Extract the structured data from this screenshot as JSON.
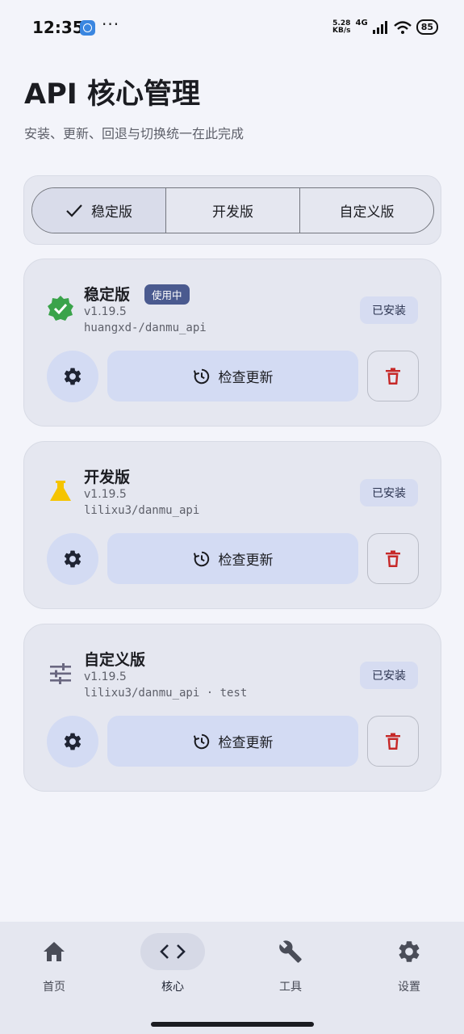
{
  "status_bar": {
    "time": "12:35",
    "dots": "···",
    "speed_value": "5.28",
    "speed_unit": "KB/s",
    "network": "4G",
    "battery": "85",
    "icons": [
      "app-icon",
      "signal-icon",
      "wifi-icon",
      "battery-icon"
    ]
  },
  "header": {
    "title": "API 核心管理",
    "subtitle": "安装、更新、回退与切换统一在此完成"
  },
  "segments": {
    "items": [
      {
        "label": "稳定版",
        "active": true
      },
      {
        "label": "开发版",
        "active": false
      },
      {
        "label": "自定义版",
        "active": false
      }
    ]
  },
  "cards": [
    {
      "name": "稳定版",
      "badge": "使用中",
      "version": "v1.19.5",
      "repo": "huangxd-/danmu_api",
      "status": "已安装",
      "update_label": "检查更新",
      "icon": "verified-badge-icon",
      "icon_color": "#3aa34a"
    },
    {
      "name": "开发版",
      "version": "v1.19.5",
      "repo": "lilixu3/danmu_api",
      "status": "已安装",
      "update_label": "检查更新",
      "icon": "flask-icon",
      "icon_color": "#f5c400"
    },
    {
      "name": "自定义版",
      "version": "v1.19.5",
      "repo": "lilixu3/danmu_api · test",
      "status": "已安装",
      "update_label": "检查更新",
      "icon": "tune-icon",
      "icon_color": "#6a6880"
    }
  ],
  "bottom_nav": {
    "items": [
      {
        "label": "首页",
        "icon": "home-icon",
        "active": false
      },
      {
        "label": "核心",
        "icon": "code-icon",
        "active": true
      },
      {
        "label": "工具",
        "icon": "wrench-icon",
        "active": false
      },
      {
        "label": "设置",
        "icon": "gear-icon",
        "active": false
      }
    ]
  },
  "colors": {
    "background": "#f3f4fa",
    "surface": "#e5e7f0",
    "tonal": "#d3dbf3",
    "delete": "#c62828",
    "badge": "#4a5a8f"
  }
}
